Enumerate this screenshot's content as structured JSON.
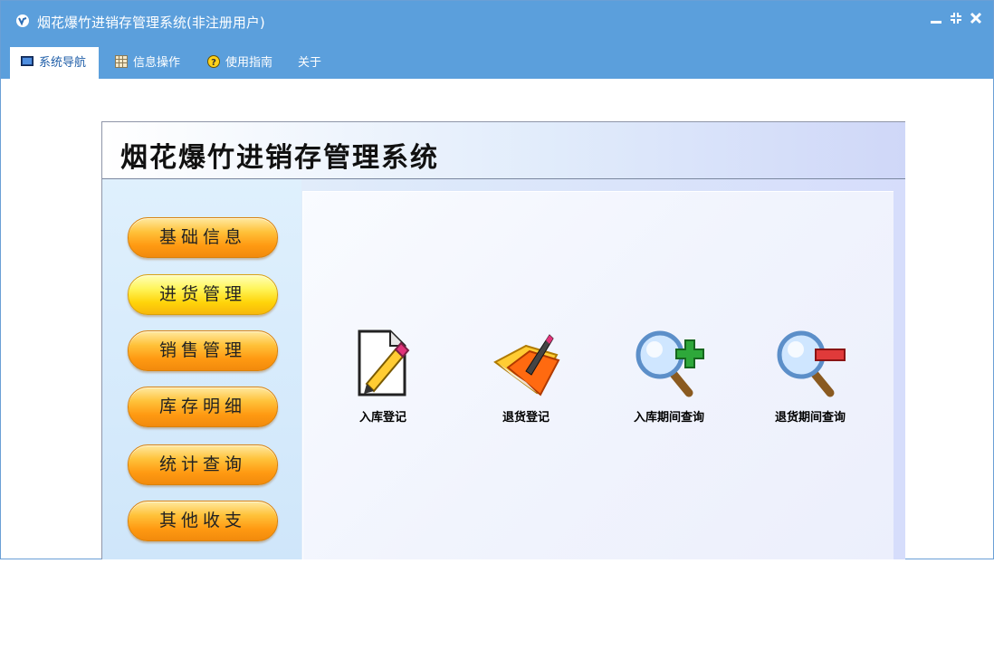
{
  "window": {
    "title": "烟花爆竹进销存管理系统(非注册用户)",
    "controls": {
      "minimize": "▁",
      "restore": "⤓",
      "close": "✕"
    }
  },
  "tabs": [
    {
      "label": "系统导航",
      "icon": "monitor-icon",
      "active": true
    },
    {
      "label": "信息操作",
      "icon": "grid-icon",
      "active": false
    },
    {
      "label": "使用指南",
      "icon": "help-icon",
      "active": false
    },
    {
      "label": "关于",
      "icon": "",
      "active": false
    }
  ],
  "panel": {
    "title": "烟花爆竹进销存管理系统",
    "nav": [
      {
        "label": "基础信息"
      },
      {
        "label": "进货管理"
      },
      {
        "label": "销售管理"
      },
      {
        "label": "库存明细"
      },
      {
        "label": "统计查询"
      },
      {
        "label": "其他收支"
      }
    ],
    "functions": [
      {
        "label": "入库登记",
        "icon": "pencil-document-icon"
      },
      {
        "label": "退货登记",
        "icon": "folder-pen-icon"
      },
      {
        "label": "入库期间查询",
        "icon": "magnifier-plus-icon"
      },
      {
        "label": "退货期间查询",
        "icon": "magnifier-minus-icon"
      }
    ]
  },
  "colors": {
    "titlebar": "#5b9fdc",
    "button_orange": "#ff9a12",
    "button_yellow": "#ffd40a"
  }
}
